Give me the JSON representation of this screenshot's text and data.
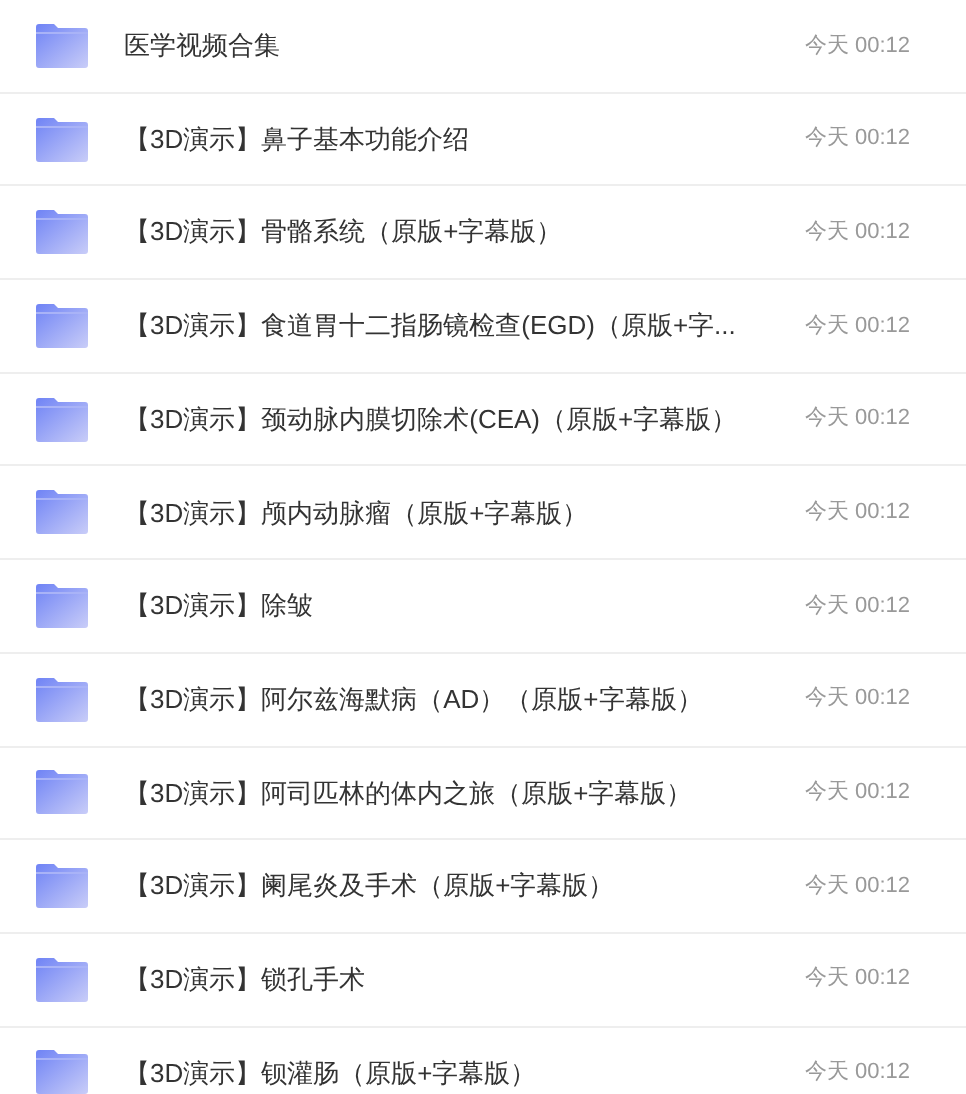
{
  "files": [
    {
      "name": "医学视频合集",
      "modified": "今天 00:12"
    },
    {
      "name": "【3D演示】鼻子基本功能介绍",
      "modified": "今天 00:12"
    },
    {
      "name": "【3D演示】骨骼系统（原版+字幕版）",
      "modified": "今天 00:12"
    },
    {
      "name": "【3D演示】食道胃十二指肠镜检查(EGD)（原版+字...",
      "modified": "今天 00:12"
    },
    {
      "name": "【3D演示】颈动脉内膜切除术(CEA)（原版+字幕版）",
      "modified": "今天 00:12"
    },
    {
      "name": "【3D演示】颅内动脉瘤（原版+字幕版）",
      "modified": "今天 00:12"
    },
    {
      "name": "【3D演示】除皱",
      "modified": "今天 00:12"
    },
    {
      "name": "【3D演示】阿尔兹海默病（AD）（原版+字幕版）",
      "modified": "今天 00:12"
    },
    {
      "name": "【3D演示】阿司匹林的体内之旅（原版+字幕版）",
      "modified": "今天 00:12"
    },
    {
      "name": "【3D演示】阑尾炎及手术（原版+字幕版）",
      "modified": "今天 00:12"
    },
    {
      "name": "【3D演示】锁孔手术",
      "modified": "今天 00:12"
    },
    {
      "name": "【3D演示】钡灌肠（原版+字幕版）",
      "modified": "今天 00:12"
    }
  ]
}
